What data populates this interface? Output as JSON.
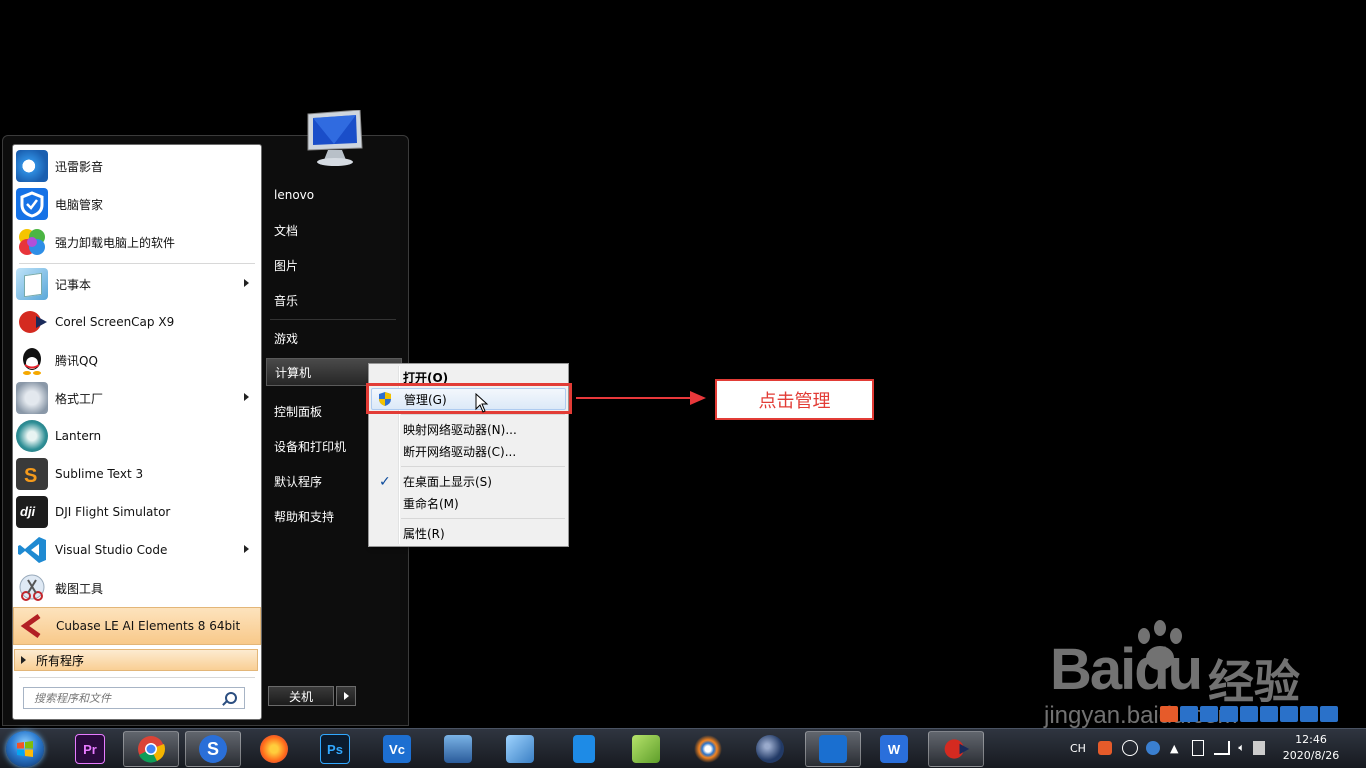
{
  "start_menu": {
    "programs": [
      {
        "label": "迅雷影音",
        "icon": "xunlei-icon"
      },
      {
        "label": "电脑管家",
        "icon": "pcmanager-icon"
      },
      {
        "label": "强力卸载电脑上的软件",
        "icon": "uninstaller-icon"
      },
      {
        "label": "记事本",
        "icon": "notepad-icon",
        "submenu": true
      },
      {
        "label": "Corel ScreenCap X9",
        "icon": "screencap-icon"
      },
      {
        "label": "腾讯QQ",
        "icon": "qq-icon"
      },
      {
        "label": "格式工厂",
        "icon": "formatfactory-icon",
        "submenu": true
      },
      {
        "label": "Lantern",
        "icon": "lantern-icon"
      },
      {
        "label": "Sublime Text 3",
        "icon": "sublime-icon"
      },
      {
        "label": "DJI Flight Simulator",
        "icon": "dji-icon"
      },
      {
        "label": "Visual Studio Code",
        "icon": "vscode-icon",
        "submenu": true
      },
      {
        "label": "截图工具",
        "icon": "snipping-icon"
      },
      {
        "label": "Cubase LE AI Elements 8 64bit",
        "icon": "cubase-icon"
      }
    ],
    "all_programs": "所有程序",
    "search_placeholder": "搜索程序和文件",
    "right_items": [
      "lenovo",
      "文档",
      "图片",
      "音乐",
      "游戏",
      "计算机",
      "控制面板",
      "设备和打印机",
      "默认程序",
      "帮助和支持"
    ],
    "shutdown": "关机"
  },
  "context_menu": {
    "items": [
      "打开(O)",
      "管理(G)",
      "映射网络驱动器(N)...",
      "断开网络驱动器(C)...",
      "在桌面上显示(S)",
      "重命名(M)",
      "属性(R)"
    ]
  },
  "annotation": {
    "callout": "点击管理",
    "color": "#e23c36"
  },
  "watermark": {
    "brand": "Baidu",
    "cn": "经验",
    "url": "jingyan.baidu.com"
  },
  "taskbar": {
    "apps": [
      "premiere",
      "chrome",
      "sogou",
      "firefox",
      "photoshop",
      "vc",
      "network",
      "flashfxp",
      "sdcard",
      "cube",
      "blender",
      "cinema4d",
      "taskmanager",
      "wps",
      "screencap"
    ],
    "tray_lang": "CH",
    "time": "12:46",
    "date": "2020/8/26"
  }
}
